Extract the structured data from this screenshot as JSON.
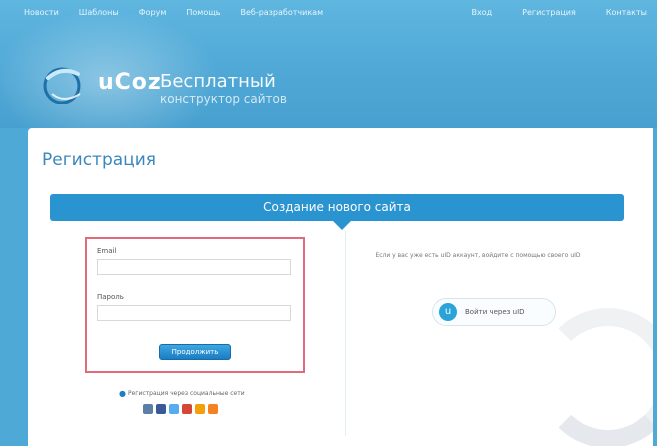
{
  "top_nav": {
    "left": [
      "Новости",
      "Шаблоны",
      "Форум",
      "Помощь",
      "Веб-разработчикам"
    ],
    "right": [
      "Вход",
      "Регистрация",
      "Контакты"
    ]
  },
  "header": {
    "logo_text": "uCoz",
    "tagline_line1": "Бесплатный",
    "tagline_line2": "конструктор сайтов"
  },
  "page_title": "Регистрация",
  "banner": {
    "label": "Создание нового сайта"
  },
  "form": {
    "email_label": "Email",
    "email_value": "",
    "password_label": "Пароль",
    "password_value": "",
    "submit_label": "Продолжить"
  },
  "social": {
    "prompt": "Регистрация через социальные сети",
    "networks": [
      "vk",
      "facebook",
      "twitter",
      "google",
      "mailru",
      "odnoklassniki"
    ]
  },
  "right_side": {
    "info_text": "Если у вас уже есть uID аккаунт, войдите с помощью своего uID",
    "uid_button_label": "Войти через uID",
    "uid_icon": "uid-logo-icon"
  },
  "colors": {
    "header_blue": "#4fa9d6",
    "bar_blue": "#2a94d0",
    "highlight_border": "#e06c7a"
  }
}
